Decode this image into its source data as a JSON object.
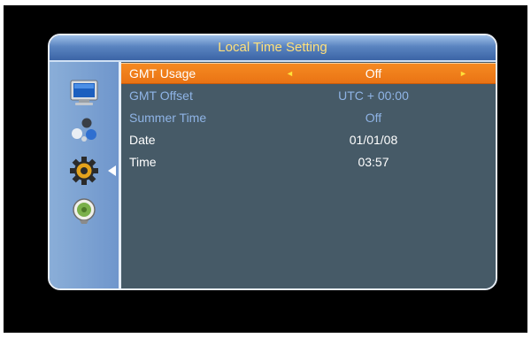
{
  "title": "Local Time Setting",
  "sidebar": {
    "items": [
      {
        "icon": "tv-monitor-icon"
      },
      {
        "icon": "dots-cluster-icon"
      },
      {
        "icon": "gear-icon"
      },
      {
        "icon": "satellite-dish-icon"
      }
    ],
    "active_index": 2
  },
  "settings": [
    {
      "label": "GMT Usage",
      "value": "Off",
      "state": "selected"
    },
    {
      "label": "GMT Offset",
      "value": "UTC + 00:00",
      "state": "disabled"
    },
    {
      "label": "Summer Time",
      "value": "Off",
      "state": "disabled"
    },
    {
      "label": "Date",
      "value": "01/01/08",
      "state": "enabled"
    },
    {
      "label": "Time",
      "value": "03:57",
      "state": "enabled"
    }
  ],
  "arrows": {
    "left": "◄",
    "right": "►"
  },
  "colors": {
    "highlight": "#f58a22",
    "title_text": "#ffe07a",
    "disabled_text": "#8fb4e6",
    "enabled_text": "#ffffff",
    "arrow": "#ffe23a"
  }
}
